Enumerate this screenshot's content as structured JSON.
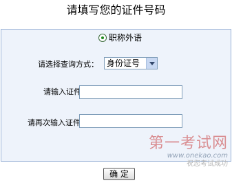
{
  "page": {
    "title": "请填写您的证件号码"
  },
  "form": {
    "radio_option": "职称外语",
    "query_method_label": "请选择查询方式：",
    "query_method_selected": "身份证号",
    "id_label": "请输入证件号：",
    "id_value": "",
    "id_confirm_label": "请再次输入证件号：",
    "id_confirm_value": ""
  },
  "buttons": {
    "confirm_label": "确  定"
  },
  "watermark": {
    "title": "第一考试网",
    "url": "www.onekao.com",
    "slogan": "祝您考试成功"
  },
  "colors": {
    "panel_bg": "#eef3fb",
    "panel_border": "#9bb3d6",
    "watermark_red": "#c93b3b"
  }
}
